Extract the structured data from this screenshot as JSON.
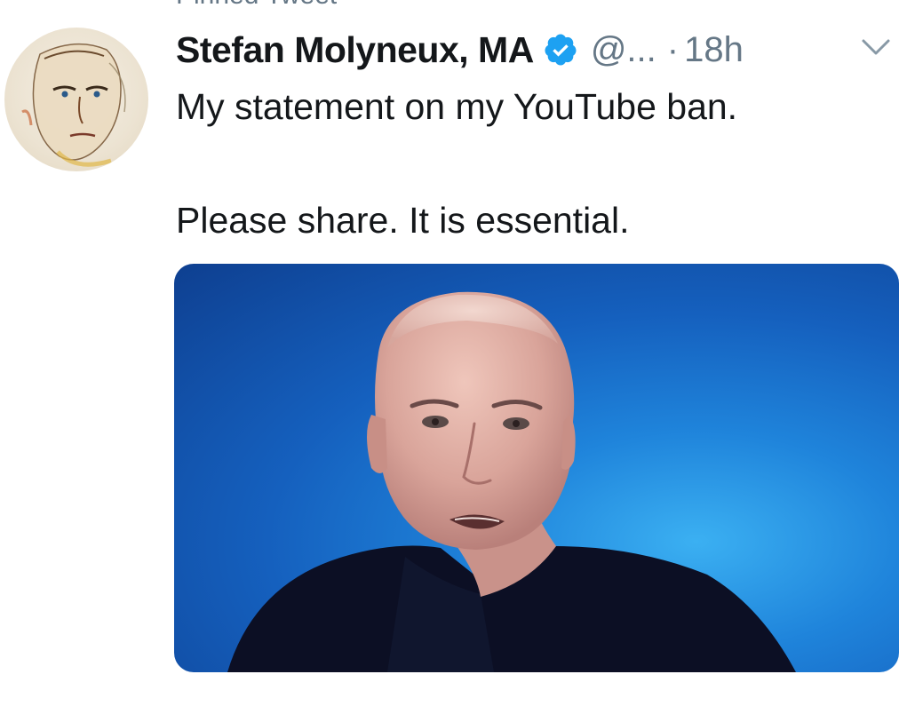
{
  "pinned_label": "Pinned Tweet",
  "tweet": {
    "author": {
      "display_name": "Stefan Molyneux, MA",
      "handle": "@...",
      "verified": true
    },
    "separator": "·",
    "timestamp": "18h",
    "text_lines": [
      "My statement on my YouTube ban.",
      "Please share. It is essential."
    ]
  },
  "icons": {
    "verified": "verified-badge-icon",
    "menu": "chevron-down-icon"
  },
  "colors": {
    "verified_blue": "#1da1f2",
    "secondary_text": "#657786",
    "primary_text": "#14171a",
    "media_background": "#1f6fd0"
  }
}
